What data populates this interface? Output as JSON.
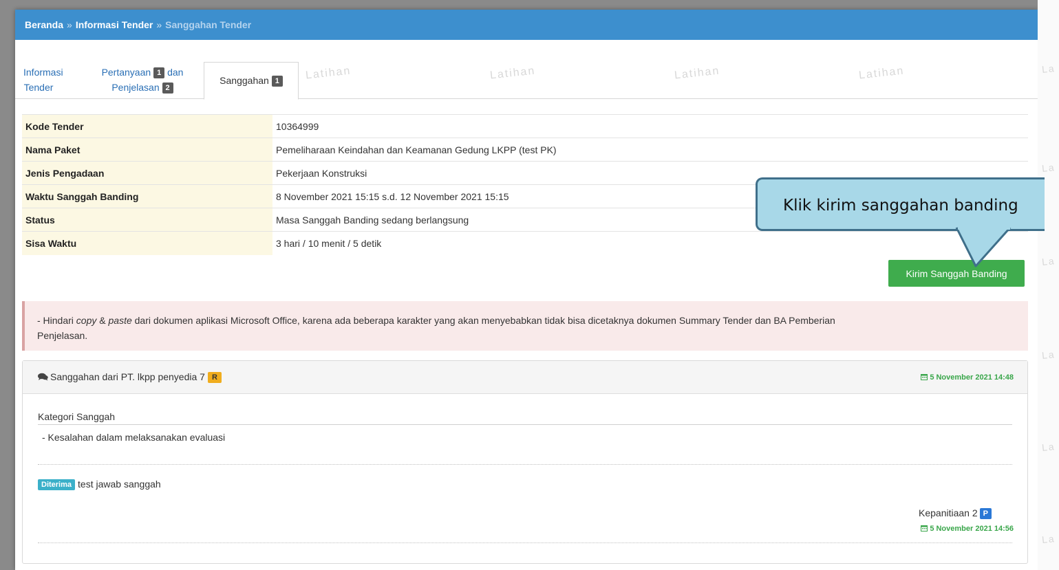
{
  "breadcrumb": {
    "home": "Beranda",
    "separator": "»",
    "tender_info": "Informasi Tender",
    "current": "Sanggahan Tender"
  },
  "tabs": {
    "informasi_line1": "Informasi",
    "informasi_line2": "Tender",
    "pertanyaan_line1": "Pertanyaan",
    "pertanyaan_badge": "1",
    "pertanyaan_dan": "dan",
    "pertanyaan_line2": "Penjelasan",
    "penjelasan_badge": "2",
    "sanggahan_label": "Sanggahan",
    "sanggahan_badge": "1"
  },
  "watermark": "Latihan",
  "watermark_partial": "La",
  "info": [
    {
      "label": "Kode Tender",
      "value": "10364999"
    },
    {
      "label": "Nama Paket",
      "value": "Pemeliharaan Keindahan dan Keamanan Gedung LKPP (test PK)"
    },
    {
      "label": "Jenis Pengadaan",
      "value": "Pekerjaan Konstruksi"
    },
    {
      "label": "Waktu Sanggah Banding",
      "value": "8 November 2021 15:15 s.d. 12 November 2021 15:15"
    },
    {
      "label": "Status",
      "value": "Masa Sanggah Banding sedang berlangsung"
    },
    {
      "label": "Sisa Waktu",
      "value": "3 hari / 10 menit / 5 detik"
    }
  ],
  "kirim_button": "Kirim Sanggah Banding",
  "callout": "Klik kirim sanggahan banding",
  "alert": {
    "prefix": "- Hindari ",
    "copy": "copy",
    "amp": " & ",
    "paste": "paste",
    "rest": " dari dokumen aplikasi Microsoft Office, karena ada beberapa karakter yang akan menyebabkan tidak bisa dicetaknya dokumen Summary Tender dan BA Pemberian",
    "line2": "Penjelasan."
  },
  "sanggahan": {
    "title": "Sanggahan dari PT. lkpp penyedia 7",
    "role_badge": "R",
    "date": "5 November 2021 14:48",
    "kategori_title": "Kategori Sanggah",
    "kategori_item": "-  Kesalahan dalam melaksanakan evaluasi",
    "status_badge": "Diterima",
    "answer": "test jawab sanggah",
    "responder": "Kepanitiaan 2",
    "responder_badge": "P",
    "answer_date": "5 November 2021 14:56"
  },
  "colors": {
    "header_blue": "#3d8fce",
    "link_blue": "#2a6fb5",
    "label_bg": "#fcf8e3",
    "button_green": "#3fac4d",
    "alert_bg": "#f9eaea",
    "callout_bg": "#a8d8e8",
    "badge_orange": "#f0ad1e",
    "badge_teal": "#3bb0c9",
    "badge_blue": "#2a78d6",
    "date_green": "#39a64a"
  }
}
